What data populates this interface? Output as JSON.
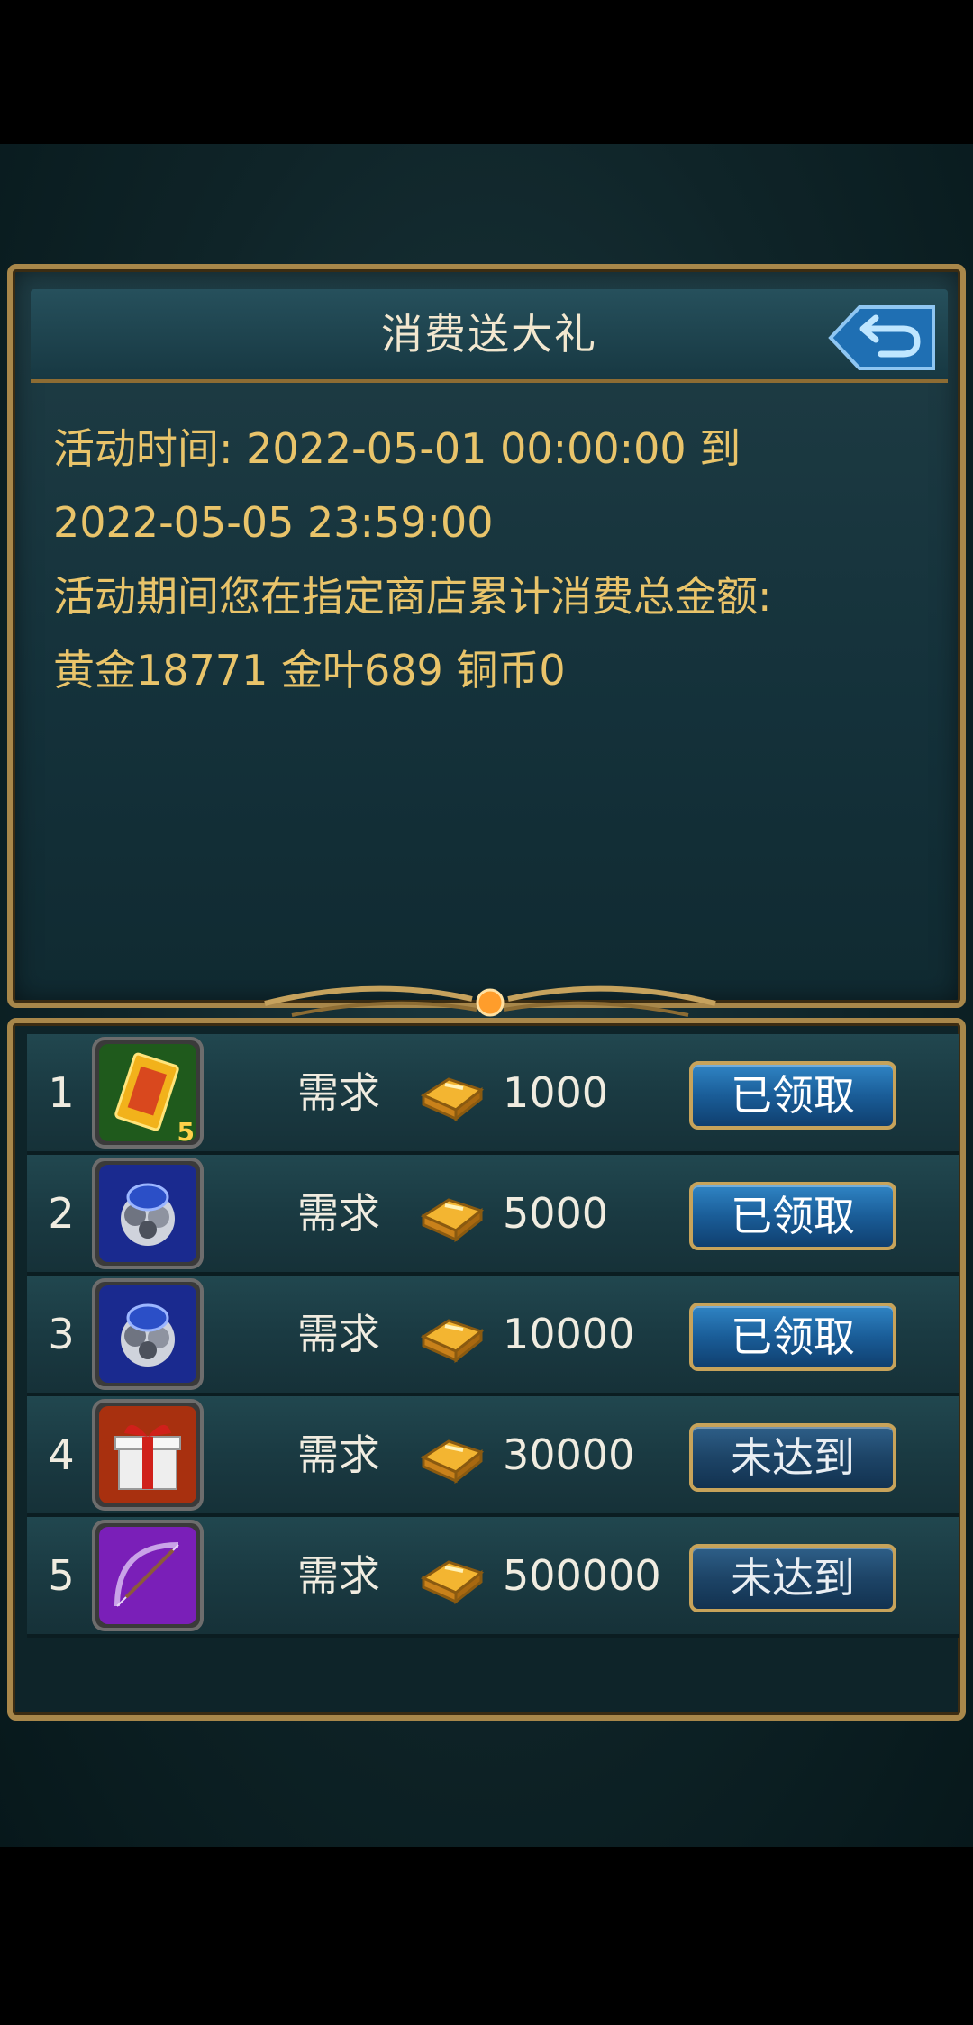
{
  "header": {
    "title": "消费送大礼"
  },
  "description": {
    "line1": "活动时间: 2022-05-01 00:00:00 到",
    "line2": "2022-05-05 23:59:00",
    "line3": " 活动期间您在指定商店累计消费总金额:",
    "line4": "黄金18771  金叶689  铜币0"
  },
  "rewards": [
    {
      "rank": "1",
      "need_label": "需求",
      "amount": "1000",
      "status": "已领取",
      "icon": "card-icon",
      "count": "5"
    },
    {
      "rank": "2",
      "need_label": "需求",
      "amount": "5000",
      "status": "已领取",
      "icon": "gem-cluster-icon"
    },
    {
      "rank": "3",
      "need_label": "需求",
      "amount": "10000",
      "status": "已领取",
      "icon": "gem-cluster-icon"
    },
    {
      "rank": "4",
      "need_label": "需求",
      "amount": "30000",
      "status": "未达到",
      "icon": "gift-box-icon"
    },
    {
      "rank": "5",
      "need_label": "需求",
      "amount": "500000",
      "status": "未达到",
      "icon": "bow-icon"
    }
  ],
  "colors": {
    "frame_gold": "#a8874a",
    "desc_text": "#e9c46a",
    "button_blue": "#1a5d98"
  }
}
